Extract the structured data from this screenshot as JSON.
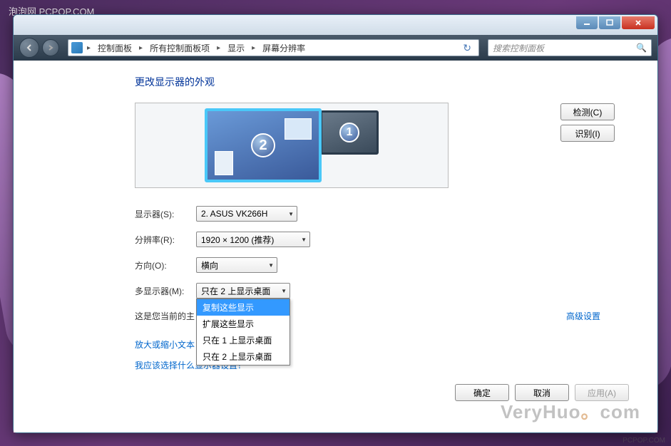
{
  "watermark_top": "泡泡网  PCPOP.COM",
  "watermark_bottom": "VeryHuo.com",
  "watermark_small": "PCPOP.COM",
  "breadcrumb": {
    "items": [
      "控制面板",
      "所有控制面板项",
      "显示",
      "屏幕分辨率"
    ]
  },
  "search": {
    "placeholder": "搜索控制面板"
  },
  "page_title": "更改显示器的外观",
  "monitors": {
    "primary_num": "1",
    "secondary_num": "2"
  },
  "buttons": {
    "detect": "检测(C)",
    "identify": "识别(I)",
    "ok": "确定",
    "cancel": "取消",
    "apply": "应用(A)"
  },
  "form": {
    "display_label": "显示器(S):",
    "display_value": "2. ASUS VK266H",
    "resolution_label": "分辨率(R):",
    "resolution_value": "1920 × 1200 (推荐)",
    "orientation_label": "方向(O):",
    "orientation_value": "横向",
    "multi_label": "多显示器(M):",
    "multi_value": "只在 2 上显示桌面"
  },
  "dropdown": {
    "items": [
      "复制这些显示",
      "扩展这些显示",
      "只在 1 上显示桌面",
      "只在 2 上显示桌面"
    ],
    "selected_index": 0
  },
  "main_display_text": "这是您当前的主",
  "advanced_link": "高级设置",
  "help_links": {
    "resize_text": "放大或缩小文本",
    "which_settings": "我应该选择什么显示器设置？"
  }
}
